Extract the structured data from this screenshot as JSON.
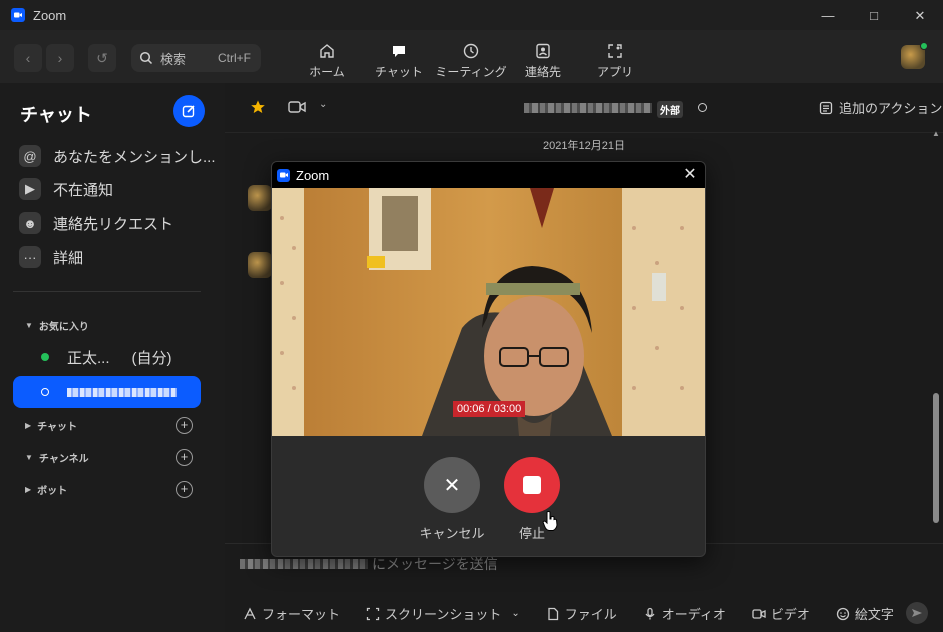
{
  "window": {
    "title": "Zoom"
  },
  "toolbar": {
    "search_placeholder": "検索",
    "search_shortcut": "Ctrl+F",
    "tabs": [
      {
        "label": "ホーム",
        "icon": "home-icon"
      },
      {
        "label": "チャット",
        "icon": "chat-icon"
      },
      {
        "label": "ミーティング",
        "icon": "clock-icon"
      },
      {
        "label": "連絡先",
        "icon": "contacts-icon"
      },
      {
        "label": "アプリ",
        "icon": "apps-icon"
      }
    ]
  },
  "sidebar": {
    "title": "チャット",
    "items": [
      {
        "label": "あなたをメンションし...",
        "icon": "at-icon"
      },
      {
        "label": "不在通知",
        "icon": "video-missed-icon"
      },
      {
        "label": "連絡先リクエスト",
        "icon": "contact-request-icon"
      },
      {
        "label": "詳細",
        "icon": "more-icon"
      }
    ],
    "sections": {
      "favorites": "お気に入り",
      "chat": "チャット",
      "channel": "チャンネル",
      "bot": "ボット"
    },
    "contacts": [
      {
        "name": "正太...",
        "suffix": "(自分)",
        "status_color": "#24c05a"
      }
    ]
  },
  "chat": {
    "external_badge": "外部",
    "add_action_label": "追加のアクション",
    "date": "2021年12月21日",
    "compose_placeholder": "にメッセージを送信",
    "tools": [
      {
        "label": "フォーマット",
        "icon": "format-icon"
      },
      {
        "label": "スクリーンショット",
        "icon": "screenshot-icon"
      },
      {
        "label": "ファイル",
        "icon": "file-icon"
      },
      {
        "label": "オーディオ",
        "icon": "mic-icon"
      },
      {
        "label": "ビデオ",
        "icon": "video-icon"
      },
      {
        "label": "絵文字",
        "icon": "emoji-icon"
      }
    ]
  },
  "dialog": {
    "title": "Zoom",
    "timer": "00:06 / 03:00",
    "cancel_label": "キャンセル",
    "stop_label": "停止"
  },
  "colors": {
    "accent": "#0b5cff",
    "stop": "#e5323b",
    "online": "#24c05a"
  }
}
